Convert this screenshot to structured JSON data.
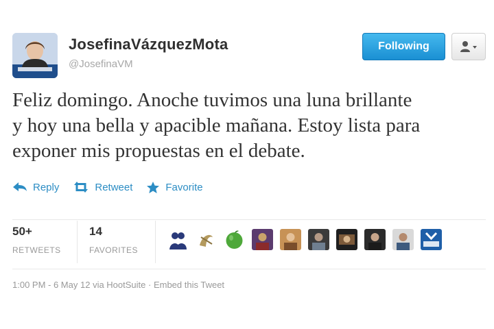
{
  "user": {
    "full_name": "JosefinaVázquezMota",
    "screen_name": "@JosefinaVM"
  },
  "header": {
    "follow_label": "Following",
    "user_menu_icon": "person-dropdown-icon"
  },
  "tweet": {
    "text_lines": [
      "Feliz domingo. Anoche tuvimos una luna brillante",
      "y hoy una bella y apacible mañana. Estoy lista para",
      "exponer mis propuestas en el debate."
    ]
  },
  "actions": {
    "reply_label": "Reply",
    "retweet_label": "Retweet",
    "favorite_label": "Favorite",
    "reply_icon": "reply-arrow-icon",
    "retweet_icon": "retweet-icon",
    "favorite_icon": "star-icon"
  },
  "stats": {
    "retweets_count": "50+",
    "retweets_label": "RETWEETS",
    "favorites_count": "14",
    "favorites_label": "FAVORITES"
  },
  "favoriters": [
    {
      "icon": "avatar-couple"
    },
    {
      "icon": "avatar-drawing"
    },
    {
      "icon": "avatar-apple"
    },
    {
      "icon": "avatar-photo"
    },
    {
      "icon": "avatar-photo"
    },
    {
      "icon": "avatar-photo"
    },
    {
      "icon": "avatar-photo"
    },
    {
      "icon": "avatar-photo"
    },
    {
      "icon": "avatar-photo"
    },
    {
      "icon": "avatar-logo"
    }
  ],
  "footer": {
    "timestamp": "1:00 PM - 6 May 12",
    "via_prefix": " via ",
    "client": "HootSuite",
    "separator": " · ",
    "embed_label": "Embed this Tweet"
  },
  "colors": {
    "link_blue": "#2c8dc4",
    "follow_blue": "#1a8fd3",
    "text_dark": "#333333",
    "muted_gray": "#999999"
  }
}
